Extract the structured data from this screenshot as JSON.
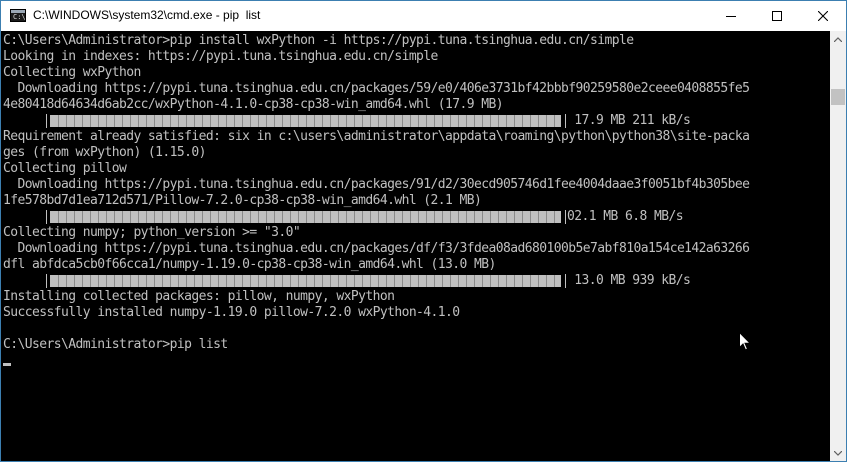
{
  "window": {
    "title": "C:\\WINDOWS\\system32\\cmd.exe - pip  list",
    "icon_label": "C:\\"
  },
  "console": {
    "lines": [
      "C:\\Users\\Administrator>pip install wxPython -i https://pypi.tuna.tsinghua.edu.cn/simple",
      "Looking in indexes: https://pypi.tuna.tsinghua.edu.cn/simple",
      "Collecting wxPython",
      "  Downloading https://pypi.tuna.tsinghua.edu.cn/packages/59/e0/406e3731bf42bbbf90259580e2ceee0408855fe5",
      "4e80418d64634d6ab2cc/wxPython-4.1.0-cp38-cp38-win_amd64.whl (17.9 MB)",
      "",
      "Requirement already satisfied: six in c:\\users\\administrator\\appdata\\roaming\\python\\python38\\site-packa",
      "ges (from wxPython) (1.15.0)",
      "Collecting pillow",
      "  Downloading https://pypi.tuna.tsinghua.edu.cn/packages/91/d2/30ecd905746d1fee4004daae3f0051bf4b305bee",
      "1fe578bd7d1ea712d571/Pillow-7.2.0-cp38-cp38-win_amd64.whl (2.1 MB)",
      "",
      "Collecting numpy; python_version >= \"3.0\"",
      "  Downloading https://pypi.tuna.tsinghua.edu.cn/packages/df/f3/3fdea08ad680100b5e7abf810a154ce142a63266",
      "dfl abfdca5cb0f66cca1/numpy-1.19.0-cp38-cp38-win_amd64.whl (13.0 MB)",
      "",
      "Installing collected packages: pillow, numpy, wxPython",
      "Successfully installed numpy-1.19.0 pillow-7.2.0 wxPython-4.1.0",
      "",
      "C:\\Users\\Administrator>pip list"
    ],
    "progress": [
      {
        "line": 5,
        "fraction": 1.0,
        "text": " 17.9 MB 211 kB/s"
      },
      {
        "line": 11,
        "fraction": 1.0,
        "text": "02.1 MB 6.8 MB/s"
      },
      {
        "line": 15,
        "fraction": 1.0,
        "text": " 13.0 MB 939 kB/s"
      }
    ]
  },
  "colors": {
    "console_bg": "#000000",
    "console_fg": "#c0c0c0",
    "titlebar_bg": "#ffffff",
    "window_border": "#3c7fb1"
  }
}
